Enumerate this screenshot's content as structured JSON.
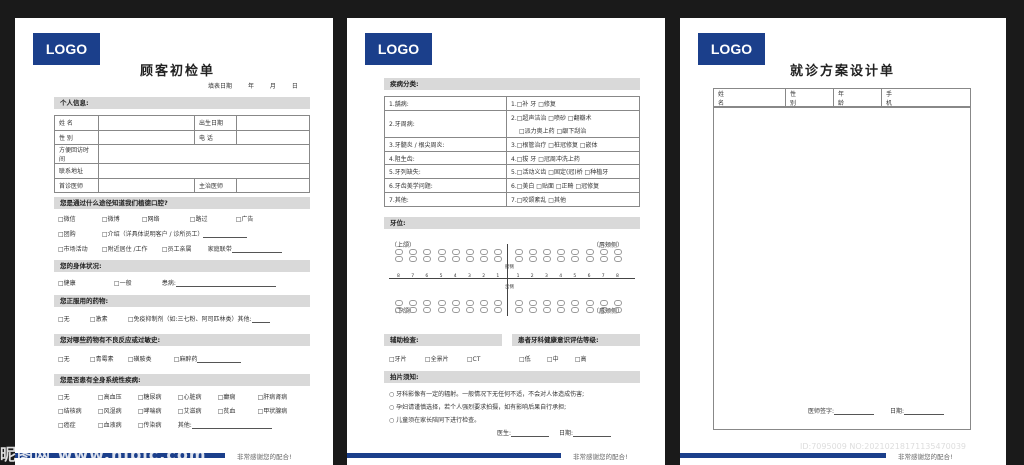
{
  "page1": {
    "logo": "LOGO",
    "title": "顾客初检单",
    "date_label": "填表日期",
    "year": "年",
    "month": "月",
    "day": "日",
    "personal_header": "个人信息:",
    "rows": [
      [
        "姓 名",
        "",
        "出生日期",
        ""
      ],
      [
        "性 别",
        "",
        "电 话",
        ""
      ],
      [
        "方便回访时间",
        "",
        "",
        ""
      ],
      [
        "联系地址",
        "",
        "",
        ""
      ],
      [
        "首诊医师",
        "",
        "主治医师",
        ""
      ]
    ],
    "channel_header": "您是通过什么途径知道我们植德口腔?",
    "channel_row1": [
      "微信",
      "微博",
      "网络",
      "路过",
      "广告"
    ],
    "channel_row2_a": "团购",
    "channel_row2_b": "介绍（详具体说明客户 / 诊所员工）",
    "channel_row3": [
      "市场活动",
      "附近居住 /工作",
      "员工亲属"
    ],
    "channel_row3_last": "家庭联带",
    "body_header": "您的身体状况:",
    "body_opts": [
      "健康",
      "一般"
    ],
    "body_ill": "患病:",
    "meds_header": "您正服用的药物:",
    "meds_opts": [
      "无",
      "激素"
    ],
    "meds_imm": "免疫抑制剂（如:三七粉、阿司匹林类）其他:",
    "allergy_header": "您对哪些药物有不良反应或过敏史:",
    "allergy_opts": [
      "无",
      "青霉素",
      "磺胺类",
      "麻醉药"
    ],
    "systemic_header": "您是否患有全身系统性疾病:",
    "systemic_rows": [
      [
        "无",
        "高血压",
        "糖尿病",
        "心脏病",
        "癫痫",
        "肝病肾病"
      ],
      [
        "结核病",
        "风湿病",
        "哮喘病",
        "艾滋病",
        "贫血",
        "甲状腺病"
      ],
      [
        "癌症",
        "血液病",
        "传染病"
      ]
    ],
    "systemic_other": "其他:",
    "thanks": "非常感谢您的配合!"
  },
  "page2": {
    "logo": "LOGO",
    "disease_header": "疾病分类:",
    "disease_rows": [
      [
        "1.龋病:",
        "1.□补 牙  □修复"
      ],
      [
        "2.牙周病:",
        "2.□超声洁治  □喷砂  □翻瓣术"
      ],
      [
        "",
        "□派力奥上药  □龈下刮治"
      ],
      [
        "3.牙髓炎 / 根尖周炎:",
        "3.□根管治疗  □桩冠修复  □嵌体"
      ],
      [
        "4.阻生齿:",
        "4.□拔 牙  □冠周冲洗上药"
      ],
      [
        "5.牙列缺失:",
        "5.□活动义齿  □固定(冠)桥  □种植牙"
      ],
      [
        "6.牙齿美学问题:",
        "6.□美白  □贴面  □正畸  □冠修复"
      ],
      [
        "7.其他:",
        "7.□咬颌紊乱  □其他"
      ]
    ],
    "tooth_header": "牙位:",
    "upper": "（上颌）",
    "lower": "（下颌）",
    "cheek": "（唇颊侧）",
    "lingual_top": "腭侧",
    "lingual_bottom": "舌侧",
    "numbers_left": [
      "8",
      "7",
      "6",
      "5",
      "4",
      "3",
      "2",
      "1"
    ],
    "numbers_right": [
      "1",
      "2",
      "3",
      "4",
      "5",
      "6",
      "7",
      "8"
    ],
    "aux_header": "辅助检查:",
    "aux_opts": [
      "牙片",
      "全景片",
      "CT"
    ],
    "eval_header": "患者牙科健康意识评估等级:",
    "eval_opts": [
      "低",
      "中",
      "高"
    ],
    "xray_header": "拍片须知:",
    "xray_notes": [
      "○ 牙科影像有一定的辐射。一般情况下无任何不适，不会对人体造成伤害;",
      "○ 孕妇请谨慎选择，若个人强烈要求拍摄，如有影响后果自行承担;",
      "○ 儿童须在家长陪同下进行检查。"
    ],
    "doctor": "医生:",
    "date": "日期:",
    "thanks": "非常感谢您的配合!"
  },
  "page3": {
    "logo": "LOGO",
    "title": "就诊方案设计单",
    "fields": [
      "姓名",
      "性别",
      "年龄",
      "手机"
    ],
    "doctor_sign": "医师签字:",
    "date": "日期:",
    "thanks": "非常感谢您的配合!"
  },
  "watermark": "昵图网 www.nipic.com",
  "image_id": "ID:7095009 NO:20210218171135470039"
}
